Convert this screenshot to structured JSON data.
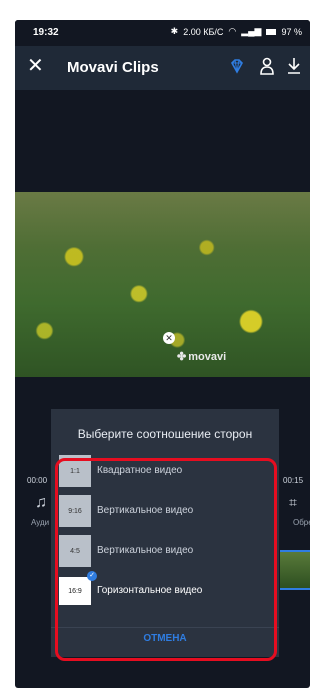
{
  "status_bar": {
    "time": "19:32",
    "net_speed": "2.00",
    "net_unit": "КБ/С",
    "battery": "97 %"
  },
  "app_bar": {
    "title": "Movavi Clips"
  },
  "video": {
    "watermark": "movavi"
  },
  "timeline": {
    "start": "00:00",
    "end": "00:15",
    "audio_label": "Ауди",
    "crop_label": "Обре"
  },
  "dialog": {
    "heading": "Выберите соотношение сторон",
    "options": [
      {
        "ratio": "1:1",
        "label": "Квадратное видео"
      },
      {
        "ratio": "9:16",
        "label": "Вертикальное видео"
      },
      {
        "ratio": "4:5",
        "label": "Вертикальное видео"
      },
      {
        "ratio": "16:9",
        "label": "Горизонтальное видео",
        "selected": true
      }
    ],
    "cancel": "ОТМЕНА"
  },
  "colors": {
    "accent": "#2f7de1",
    "highlight": "#e60d20",
    "dialog_bg": "#2b3340",
    "app_bg": "#121722"
  }
}
